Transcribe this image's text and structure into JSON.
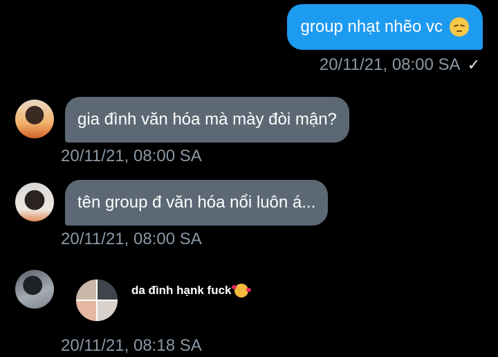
{
  "messages": [
    {
      "direction": "outgoing",
      "text": "group nhạt nhẽo vc",
      "emoji": "pensive-face-emoji",
      "timestamp": "20/11/21, 08:00 SA",
      "status_icon": "check-icon",
      "status_glyph": "✓"
    },
    {
      "direction": "incoming",
      "text": "gia đình văn hóa mà mày đòi mận?",
      "timestamp": "20/11/21, 08:00 SA"
    },
    {
      "direction": "incoming",
      "text": "tên group đ văn hóa nổi luôn á...",
      "timestamp": "20/11/21, 08:00 SA"
    },
    {
      "direction": "incoming",
      "type": "sticker",
      "caption": "da đình hạnk fuck",
      "emoji": "smiling-face-with-hearts-emoji",
      "timestamp": "20/11/21, 08:18 SA"
    }
  ],
  "colors": {
    "background": "#000000",
    "outgoing_bubble": "#1d9bf0",
    "incoming_bubble": "#5c6975",
    "timestamp": "#8b98a5"
  }
}
